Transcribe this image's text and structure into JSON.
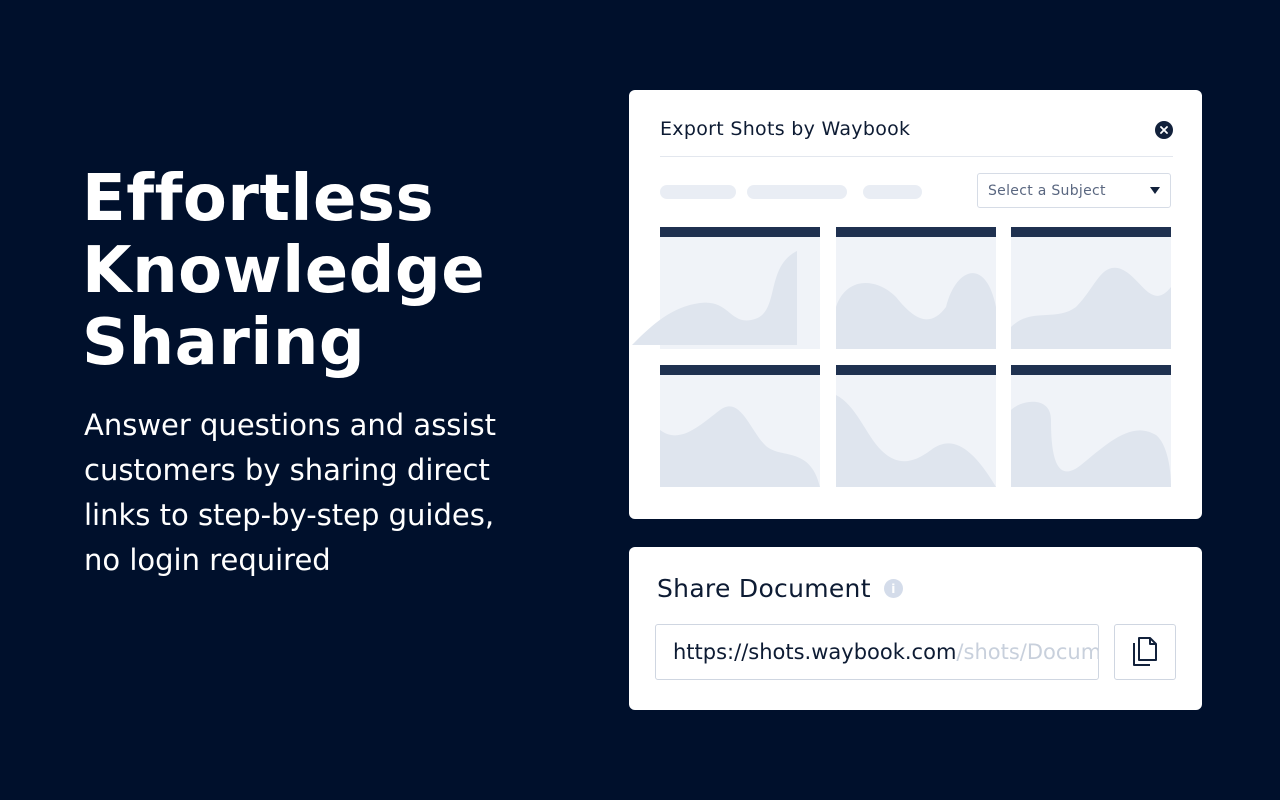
{
  "hero": {
    "title_line1": "Effortless",
    "title_line2": "Knowledge",
    "title_line3": "Sharing",
    "subtitle_line1": "Answer questions and assist",
    "subtitle_line2": "customers by sharing direct",
    "subtitle_line3": "links to step-by-step guides,",
    "subtitle_line4": "no login required"
  },
  "export_panel": {
    "title": "Export Shots by Waybook",
    "close_icon": "close-icon",
    "subject_select": {
      "selected": "Select a Subject"
    },
    "thumbnail_count": 6
  },
  "share_panel": {
    "title": "Share Document",
    "info_icon": "i",
    "url_visible": "https://shots.waybook.com",
    "url_faded": "/shots/Document",
    "copy_icon": "copy-icon"
  },
  "colors": {
    "background": "#00102c",
    "card": "#ffffff",
    "thumb_bar": "#1f3150",
    "thumb_fill": "#f0f3f8",
    "wave": "#dfe5ee"
  }
}
